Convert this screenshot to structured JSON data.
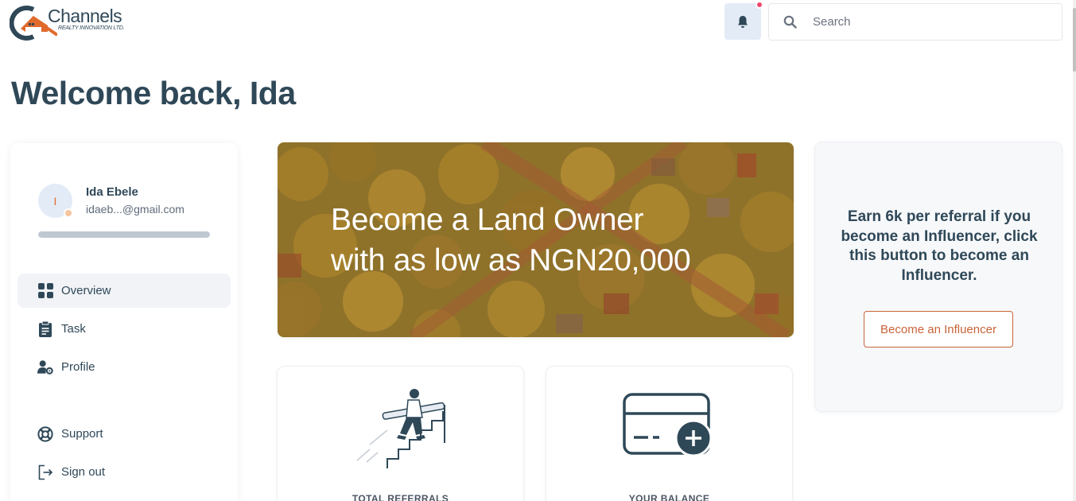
{
  "brand": {
    "name": "Channels",
    "tagline": "REALTY INNOVATION LTD."
  },
  "header": {
    "notifications_unread": true,
    "search": {
      "placeholder": "Search",
      "value": ""
    }
  },
  "page": {
    "title": "Welcome back, Ida"
  },
  "sidebar": {
    "user": {
      "initial": "I",
      "name": "Ida Ebele",
      "email": "idaeb...@gmail.com",
      "profile_completion": 1.0
    },
    "items": [
      {
        "label": "Overview",
        "icon": "grid-icon",
        "active": true
      },
      {
        "label": "Task",
        "icon": "clipboard-icon",
        "active": false
      },
      {
        "label": "Profile",
        "icon": "user-gear-icon",
        "active": false
      },
      {
        "label": "Support",
        "icon": "lifebuoy-icon",
        "active": false
      },
      {
        "label": "Sign out",
        "icon": "sign-out-icon",
        "active": false
      }
    ]
  },
  "banner": {
    "line1": "Become a Land Owner",
    "line2": "with as low as NGN20,000"
  },
  "influencer": {
    "text": "Earn 6k per referral if you become an Influencer, click this button to become an Influencer.",
    "button_label": "Become an Influencer"
  },
  "stats": [
    {
      "label": "TOTAL REFERRALS",
      "illustration": "stairs-climber-illustration"
    },
    {
      "label": "YOUR BALANCE",
      "illustration": "card-add-icon"
    }
  ],
  "colors": {
    "primary": "#2f4858",
    "accent": "#c8643a",
    "notification": "#f0466d",
    "bell_bg": "#e3ebf7"
  }
}
